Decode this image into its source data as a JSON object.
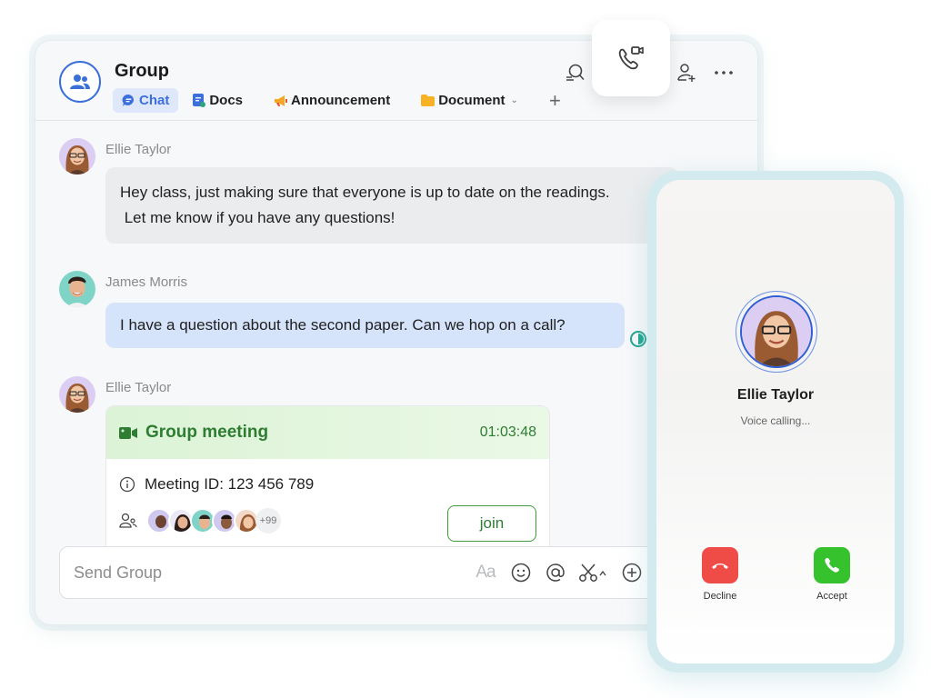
{
  "header": {
    "title": "Group",
    "tabs": [
      {
        "label": "Chat",
        "icon": "chat-bubble-icon",
        "active": true
      },
      {
        "label": "Docs",
        "icon": "docs-icon",
        "active": false
      },
      {
        "label": "Announcement",
        "icon": "megaphone-icon",
        "active": false
      },
      {
        "label": "Document",
        "icon": "folder-icon",
        "active": false,
        "dropdown": true
      }
    ],
    "add_tab": "+",
    "icons": [
      "search-icon",
      "call-video-icon",
      "add-member-icon",
      "more-icon"
    ]
  },
  "messages": [
    {
      "sender": "Ellie Taylor",
      "lines": [
        "Hey class, just making sure that everyone is up to date on the readings.",
        " Let me know if you have any questions!"
      ]
    },
    {
      "sender": "James Morris",
      "lines": [
        "I have a question about the second paper. Can we hop on a call?"
      ]
    },
    {
      "sender": "Ellie Taylor",
      "type": "meeting"
    }
  ],
  "meeting": {
    "title": "Group meeting",
    "duration": "01:03:48",
    "meeting_id": "Meeting ID: 123 456 789",
    "more_participants": "+99",
    "join_label": "join"
  },
  "input": {
    "placeholder": "Send Group",
    "format_label": "Aa"
  },
  "call": {
    "caller": "Ellie Taylor",
    "status": "Voice calling...",
    "decline_label": "Decline",
    "accept_label": "Accept"
  },
  "colors": {
    "accent": "#3b6fdc",
    "meeting_green": "#2e7d32",
    "decline": "#ef4b47",
    "accept": "#36c22d"
  }
}
